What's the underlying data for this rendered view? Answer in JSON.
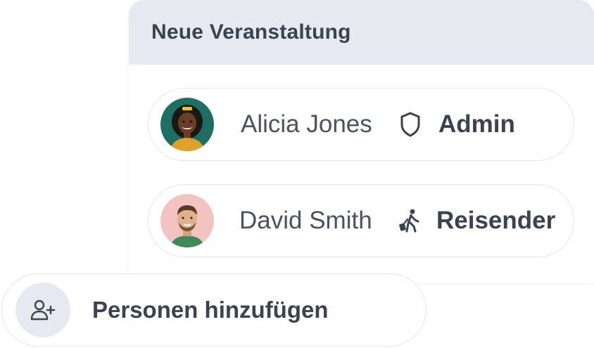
{
  "event": {
    "title": "Neue Veranstaltung"
  },
  "participants": [
    {
      "name": "Alicia Jones",
      "role": "Admin",
      "role_icon": "shield-icon"
    },
    {
      "name": "David Smith",
      "role": "Reisender",
      "role_icon": "traveler-icon"
    }
  ],
  "add_person": {
    "label": "Personen hinzufügen",
    "icon": "add-user-icon"
  },
  "colors": {
    "header_bg": "#e6e9ef",
    "text_dark": "#3b4250",
    "text_name": "#4b5260",
    "border": "#e3e6ea"
  }
}
